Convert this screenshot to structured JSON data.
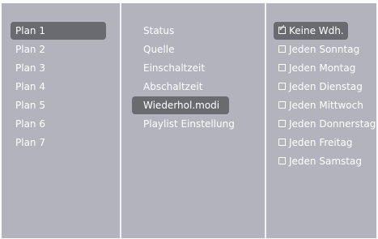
{
  "plans": {
    "items": [
      "Plan 1",
      "Plan 2",
      "Plan 3",
      "Plan 4",
      "Plan 5",
      "Plan 6",
      "Plan 7"
    ],
    "selected_index": 0
  },
  "settings": {
    "items": [
      "Status",
      "Quelle",
      "Einschaltzeit",
      "Abschaltzeit",
      "Wiederhol.modi",
      "Playlist Einstellung"
    ],
    "selected_index": 4
  },
  "repeat": {
    "options": [
      {
        "label": "Keine Wdh.",
        "checked": true
      },
      {
        "label": "Jeden Sonntag",
        "checked": false
      },
      {
        "label": "Jeden Montag",
        "checked": false
      },
      {
        "label": "Jeden Dienstag",
        "checked": false
      },
      {
        "label": "Jeden Mittwoch",
        "checked": false
      },
      {
        "label": "Jeden Donnerstag",
        "checked": false
      },
      {
        "label": "Jeden Freitag",
        "checked": false
      },
      {
        "label": "Jeden Samstag",
        "checked": false
      }
    ],
    "selected_index": 0
  },
  "colors": {
    "panel": "#b2b3bd",
    "highlight": "#6a6b70",
    "text": "#ffffff"
  }
}
